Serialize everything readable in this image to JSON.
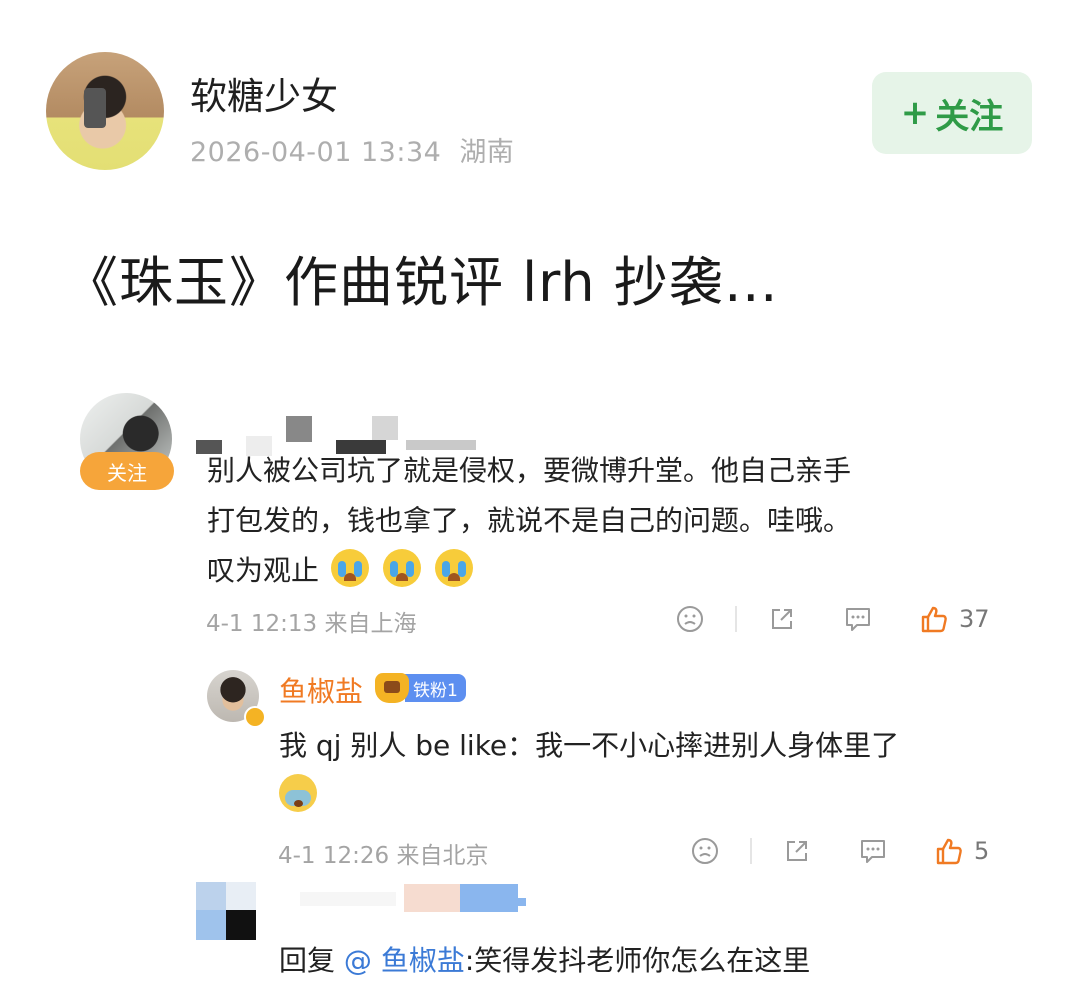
{
  "post": {
    "author": "软糖少女",
    "date": "2026-04-01 13:34",
    "location": "湖南",
    "follow_plus": "+",
    "follow_label": "关注",
    "title": "《珠玉》作曲锐评 lrh 抄袭…"
  },
  "comments": [
    {
      "follow_label": "关注",
      "text_line1": "别人被公司坑了就是侵权，要微博升堂。他自己亲手",
      "text_line2": "打包发的，钱也拿了，就说不是自己的问题。哇哦。",
      "text_line3": "叹为观止",
      "emoji": [
        "cry-emoji",
        "cry-emoji",
        "cry-emoji"
      ],
      "time": "4-1 12:13",
      "from": "来自上海",
      "likes": "37"
    }
  ],
  "replies": [
    {
      "name": "鱼椒盐",
      "fan_badge": "铁粉1",
      "text": "我 qj 别人 be like：我一不小心摔进别人身体里了",
      "emoji": "sob-emoji",
      "time": "4-1 12:26",
      "from": "来自北京",
      "likes": "5"
    },
    {
      "reply_prefix": "回复",
      "mention": "@ 鱼椒盐",
      "text": ":笑得发抖老师你怎么在这里"
    }
  ],
  "colors": {
    "follow_green": "#2f9b47",
    "follow_bg": "#e6f4e8",
    "follow_orange": "#f6a53a",
    "username_orange": "#f07a23",
    "like_orange": "#f07a23",
    "mention_blue": "#3b7ad6",
    "fan_badge_blue": "#5d8ff0"
  },
  "icons": [
    "dislike-face-icon",
    "share-icon",
    "comment-icon",
    "like-thumb-icon"
  ]
}
